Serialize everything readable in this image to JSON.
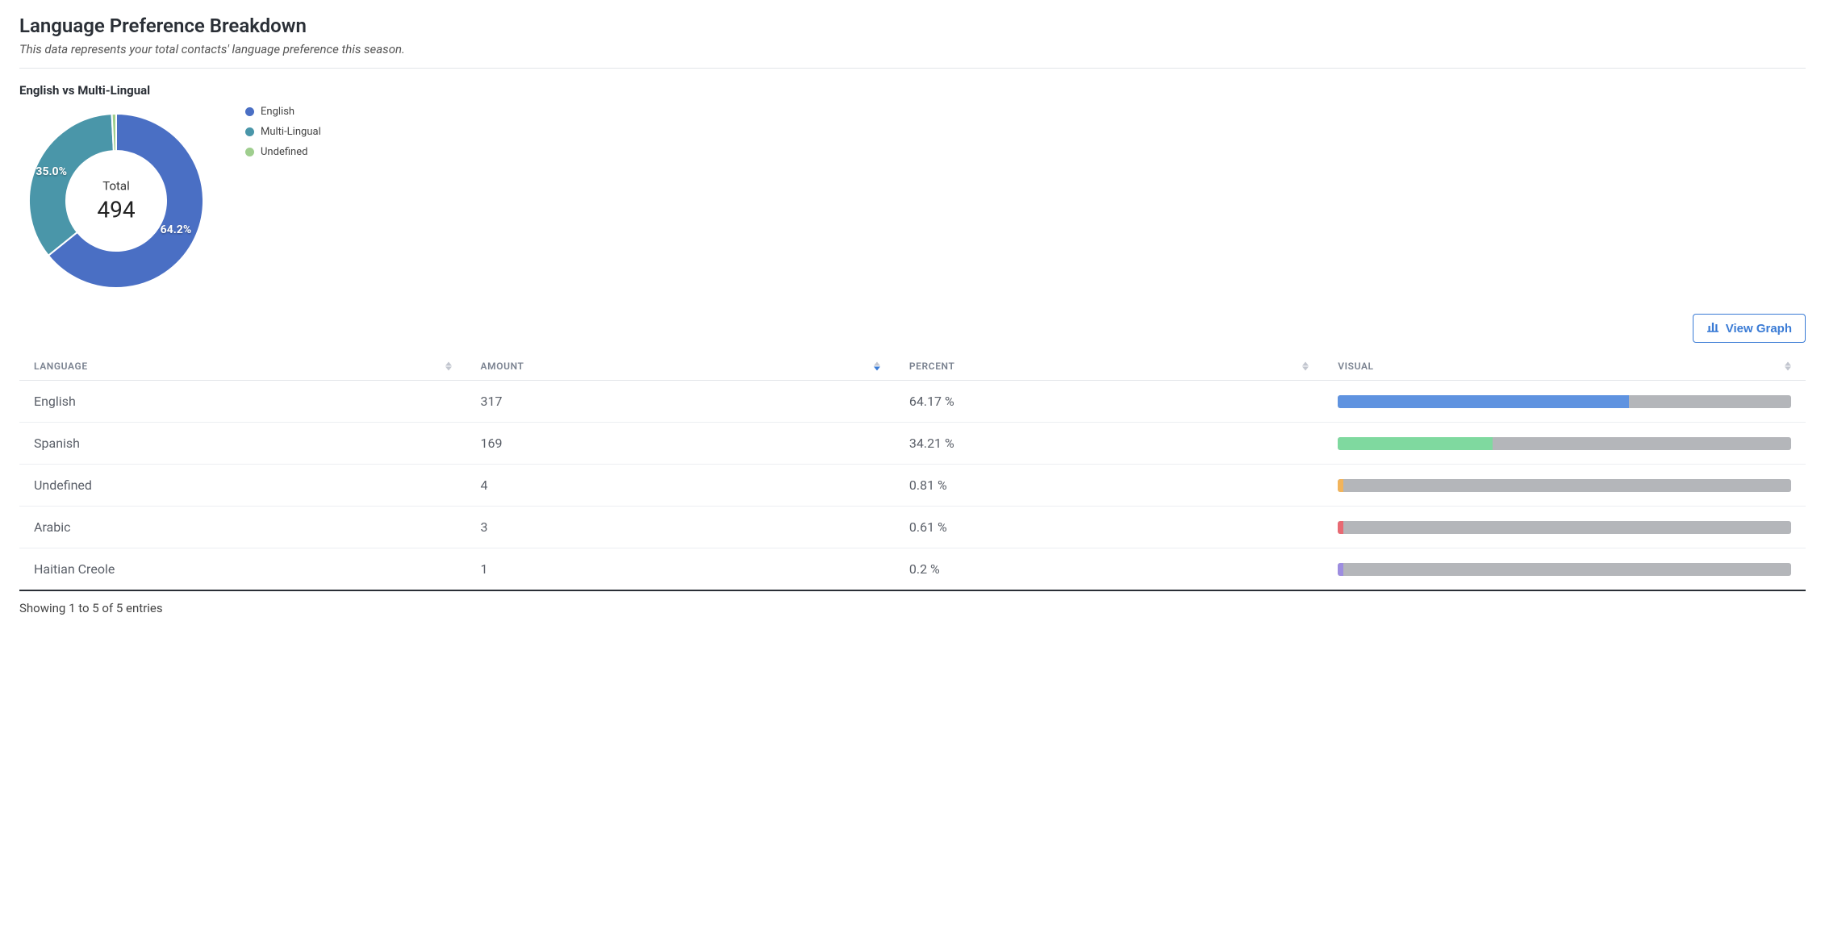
{
  "header": {
    "title": "Language Preference Breakdown",
    "subtitle": "This data represents your total contacts' language preference this season."
  },
  "chart_data": {
    "type": "pie",
    "title": "English vs Multi-Lingual",
    "center_label": "Total",
    "center_value": "494",
    "series": [
      {
        "name": "English",
        "value": 317,
        "percent": 64.2,
        "label": "64.2%",
        "color": "#4a6fc4"
      },
      {
        "name": "Multi-Lingual",
        "value": 173,
        "percent": 35.0,
        "label": "35.0%",
        "color": "#4a96a9"
      },
      {
        "name": "Undefined",
        "value": 4,
        "percent": 0.8,
        "label": "",
        "color": "#9fce8e"
      }
    ],
    "legend": [
      "English",
      "Multi-Lingual",
      "Undefined"
    ]
  },
  "buttons": {
    "view_graph": "View Graph"
  },
  "table": {
    "columns": {
      "language": "LANGUAGE",
      "amount": "AMOUNT",
      "percent": "PERCENT",
      "visual": "VISUAL"
    },
    "sorted_column": "amount",
    "rows": [
      {
        "language": "English",
        "amount": "317",
        "percent": "64.17 %",
        "bar_percent": 64.17,
        "bar_color": "#5f93e0"
      },
      {
        "language": "Spanish",
        "amount": "169",
        "percent": "34.21 %",
        "bar_percent": 34.21,
        "bar_color": "#7fd99f"
      },
      {
        "language": "Undefined",
        "amount": "4",
        "percent": "0.81 %",
        "bar_percent": 0.81,
        "bar_color": "#f2b45b"
      },
      {
        "language": "Arabic",
        "amount": "3",
        "percent": "0.61 %",
        "bar_percent": 0.61,
        "bar_color": "#e86a73"
      },
      {
        "language": "Haitian Creole",
        "amount": "1",
        "percent": "0.2 %",
        "bar_percent": 0.2,
        "bar_color": "#9d8de0"
      }
    ],
    "footer": "Showing 1 to 5 of 5 entries"
  }
}
